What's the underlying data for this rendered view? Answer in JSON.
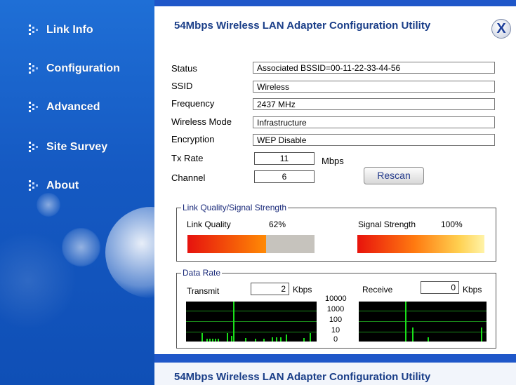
{
  "sidebar": {
    "items": [
      {
        "label": "Link Info"
      },
      {
        "label": "Configuration"
      },
      {
        "label": "Advanced"
      },
      {
        "label": "Site Survey"
      },
      {
        "label": "About"
      }
    ]
  },
  "header": {
    "title": "54Mbps Wireless LAN Adapter Configuration Utility",
    "close_label": "X"
  },
  "fields": {
    "status": {
      "label": "Status",
      "value": "Associated BSSID=00-11-22-33-44-56"
    },
    "ssid": {
      "label": "SSID",
      "value": "Wireless"
    },
    "frequency": {
      "label": "Frequency",
      "value": "2437 MHz"
    },
    "wireless_mode": {
      "label": "Wireless Mode",
      "value": "Infrastructure"
    },
    "encryption": {
      "label": "Encryption",
      "value": "WEP Disable"
    },
    "tx_rate": {
      "label": "Tx Rate",
      "value": "11",
      "unit": "Mbps"
    },
    "channel": {
      "label": "Channel",
      "value": "6"
    }
  },
  "rescan_label": "Rescan",
  "link_quality_group": {
    "title": "Link Quality/Signal Strength",
    "link_quality_label": "Link Quality",
    "link_quality_value": "62%",
    "link_quality_fraction": 0.62,
    "signal_strength_label": "Signal Strength",
    "signal_strength_value": "100%",
    "signal_strength_fraction": 1.0
  },
  "data_rate_group": {
    "title": "Data Rate",
    "transmit_label": "Transmit",
    "transmit_value": "2",
    "receive_label": "Receive",
    "receive_value": "0",
    "unit": "Kbps",
    "scale_labels": [
      "10000",
      "1000",
      "100",
      "10",
      "0"
    ]
  },
  "footer": {
    "title": "54Mbps Wireless LAN Adapter Configuration Utility"
  },
  "colors": {
    "sidebar_blue": "#1559c2",
    "title_blue": "#1a3e88",
    "graph_green": "#19e019"
  }
}
